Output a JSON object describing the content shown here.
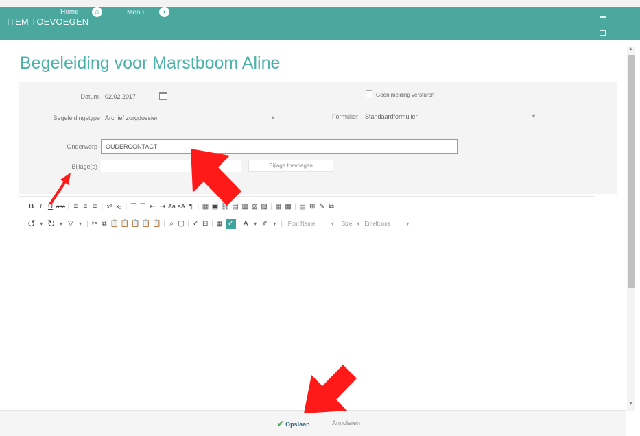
{
  "window": {
    "app_title": "ITEM TOEVOEGEN",
    "home_label": "Home",
    "menu_label": "Menu"
  },
  "page": {
    "title": "Begeleiding voor Marstboom Aline"
  },
  "form": {
    "date_label": "Datum",
    "date_value": "02.02.2017",
    "no_notify_label": "Geen melding versturen",
    "type_label": "Begeleidingstype",
    "type_value": "Archief zorgdossier",
    "formulier_label": "Formulier",
    "formulier_value": "Standaardformulier",
    "subject_label": "Onderwerp",
    "subject_value": "OUDERCONTACT",
    "attachment_label": "Bijlage(s)",
    "add_attachment_button": "Bijlage toevoegen"
  },
  "editor": {
    "font_name_placeholder": "Font Name",
    "size_placeholder": "Size",
    "font_dd_arrow": "▾",
    "size_dd_arrow": "▾",
    "format_dd_arrow": "▾",
    "format_placeholder": "Emeltcons"
  },
  "footer": {
    "save_label": "Opslaan",
    "cancel_label": "Annuleren"
  },
  "colors": {
    "accent": "#4aa89f",
    "title": "#4ab2a8",
    "arrow": "#ff1a1a"
  }
}
